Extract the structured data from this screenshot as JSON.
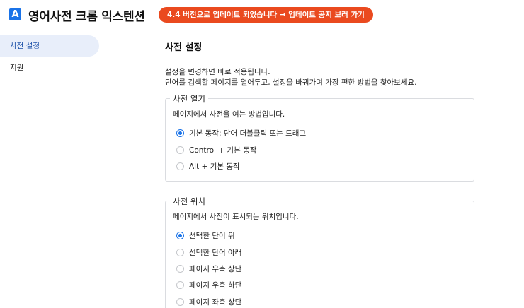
{
  "app": {
    "logo_letter": "A",
    "title": "영어사전 크롬 익스텐션",
    "update_notice": "4.4 버전으로 업데이트 되었습니다 → 업데이트 공지 보러 가기"
  },
  "sidebar": {
    "items": [
      {
        "label": "사전 설정",
        "active": true
      },
      {
        "label": "지원",
        "active": false
      }
    ]
  },
  "main": {
    "title": "사전 설정",
    "description_lines": [
      "설정을 변경하면 바로 적용됩니다.",
      "단어를 검색할 페이지를 열어두고, 설정을 바꿔가며 가장 편한 방법을 찾아보세요."
    ],
    "open_section": {
      "legend": "사전 열기",
      "description": "페이지에서 사전을 여는 방법입니다.",
      "options": [
        {
          "label": "기본 동작: 단어 더블클릭 또는 드래그",
          "checked": true
        },
        {
          "label": "Control + 기본 동작",
          "checked": false
        },
        {
          "label": "Alt + 기본 동작",
          "checked": false
        }
      ]
    },
    "position_section": {
      "legend": "사전 위치",
      "description": "페이지에서 사전이 표시되는 위치입니다.",
      "options": [
        {
          "label": "선택한 단어 위",
          "checked": true
        },
        {
          "label": "선택한 단어 아래",
          "checked": false
        },
        {
          "label": "페이지 우측 상단",
          "checked": false
        },
        {
          "label": "페이지 우측 하단",
          "checked": false
        },
        {
          "label": "페이지 좌측 상단",
          "checked": false
        }
      ]
    }
  },
  "colors": {
    "accent": "#1a73e8",
    "update_pill": "#ea4a1f",
    "sidebar_active_bg": "#e8eefa"
  }
}
